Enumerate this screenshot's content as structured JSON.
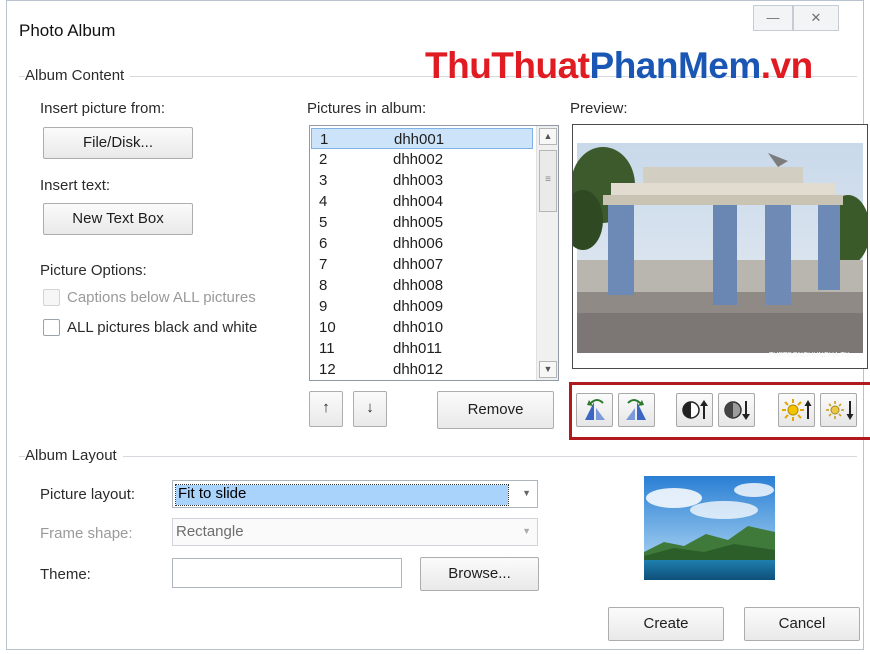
{
  "window": {
    "title": "Photo Album",
    "minimize_glyph": "—",
    "close_glyph": "✕"
  },
  "watermark": {
    "part1": "ThuThuat",
    "part2": "PhanMem",
    "part3": ".vn"
  },
  "album_content": {
    "group_label": "Album Content",
    "insert_picture_from_label": "Insert picture from:",
    "file_disk_button": "File/Disk...",
    "insert_text_label": "Insert text:",
    "new_text_box_button": "New Text Box",
    "picture_options_label": "Picture Options:",
    "captions_checkbox_label": "Captions below ALL pictures",
    "black_white_checkbox_label": "ALL pictures black and white"
  },
  "pictures_in_album": {
    "label": "Pictures in album:",
    "items": [
      {
        "num": "1",
        "name": "dhh001"
      },
      {
        "num": "2",
        "name": "dhh002"
      },
      {
        "num": "3",
        "name": "dhh003"
      },
      {
        "num": "4",
        "name": "dhh004"
      },
      {
        "num": "5",
        "name": "dhh005"
      },
      {
        "num": "6",
        "name": "dhh006"
      },
      {
        "num": "7",
        "name": "dhh007"
      },
      {
        "num": "8",
        "name": "dhh008"
      },
      {
        "num": "9",
        "name": "dhh009"
      },
      {
        "num": "10",
        "name": "dhh010"
      },
      {
        "num": "11",
        "name": "dhh011"
      },
      {
        "num": "12",
        "name": "dhh012"
      }
    ],
    "selected_index": 0,
    "move_up_glyph": "↑",
    "move_down_glyph": "↓",
    "remove_button": "Remove"
  },
  "preview": {
    "label": "Preview:",
    "image_caption": "THPTDONGHUNGHA.TK",
    "tools": [
      {
        "name": "rotate-left-icon"
      },
      {
        "name": "rotate-right-icon"
      },
      {
        "name": "contrast-up-icon"
      },
      {
        "name": "contrast-down-icon"
      },
      {
        "name": "brightness-up-icon"
      },
      {
        "name": "brightness-down-icon"
      }
    ]
  },
  "album_layout": {
    "group_label": "Album Layout",
    "picture_layout_label": "Picture layout:",
    "picture_layout_value": "Fit to slide",
    "frame_shape_label": "Frame shape:",
    "frame_shape_value": "Rectangle",
    "theme_label": "Theme:",
    "theme_value": "",
    "browse_button": "Browse..."
  },
  "footer": {
    "create_button": "Create",
    "cancel_button": "Cancel"
  },
  "colors": {
    "highlight_frame": "#b01a1e",
    "selection": "#cde3f9",
    "watermark_red": "#e01b22",
    "watermark_blue": "#1a56b4"
  }
}
